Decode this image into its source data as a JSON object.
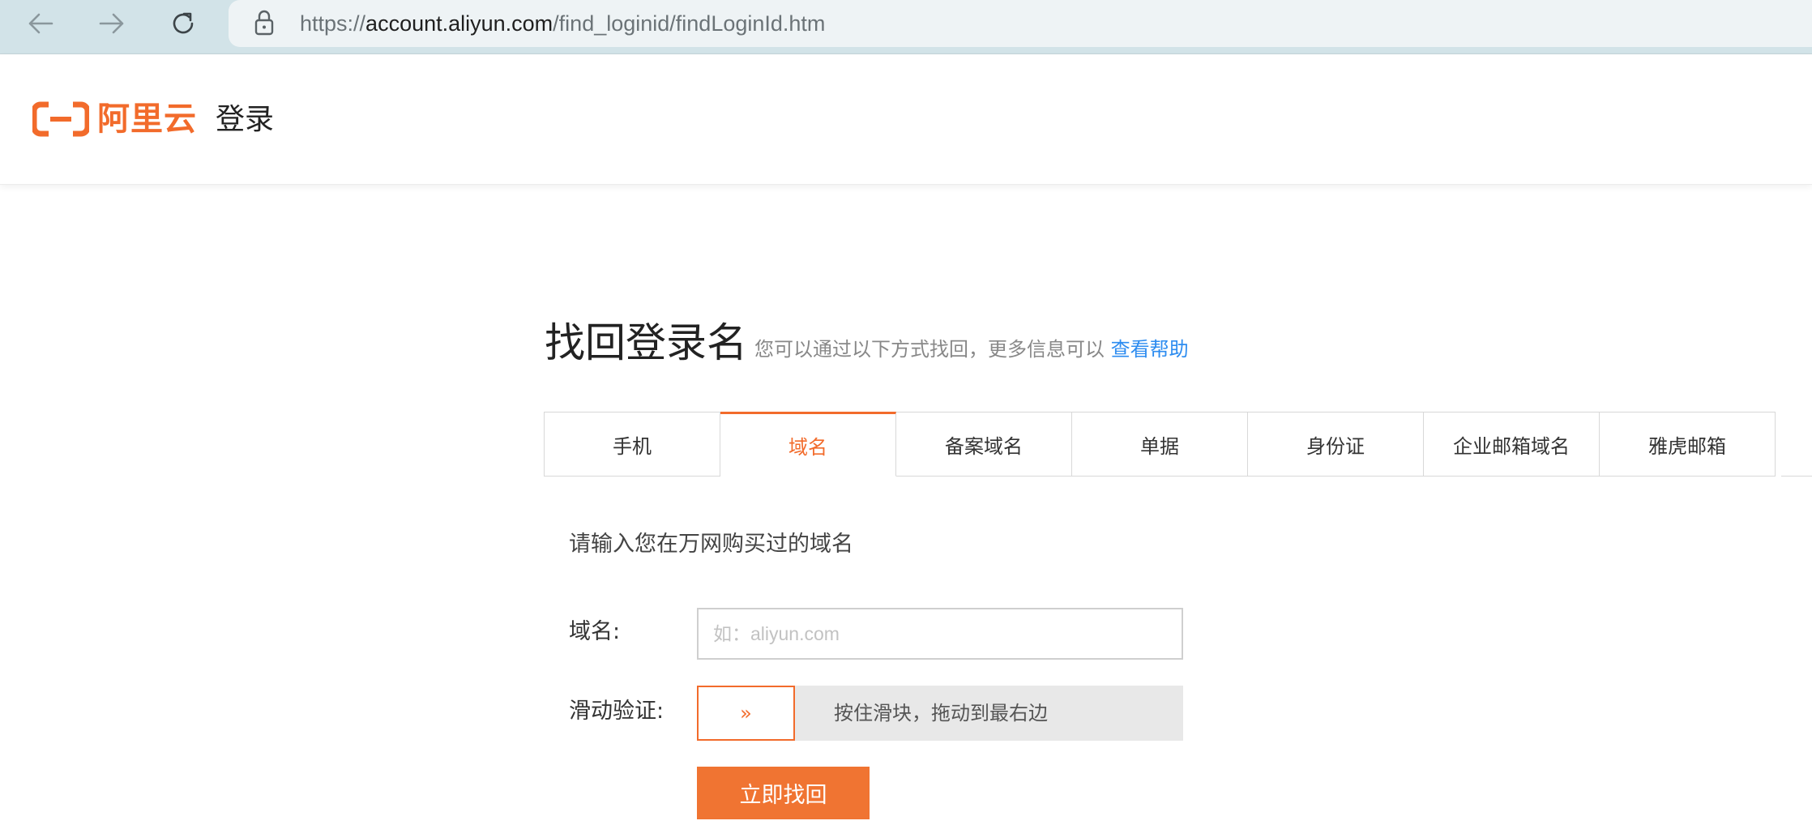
{
  "browser": {
    "url_scheme": "https://",
    "url_host": "account.aliyun.com",
    "url_path": "/find_loginid/findLoginId.htm",
    "icons": [
      "back-icon",
      "forward-icon",
      "reload-icon",
      "lock-icon"
    ]
  },
  "header": {
    "logo_text": "阿里云",
    "title": "登录",
    "brand_color": "#f26b2b"
  },
  "main": {
    "title": "找回登录名",
    "subtitle": "您可以通过以下方式找回，更多信息可以",
    "help_link": "查看帮助",
    "tabs": [
      {
        "label": "手机",
        "active": false
      },
      {
        "label": "域名",
        "active": true
      },
      {
        "label": "备案域名",
        "active": false
      },
      {
        "label": "单据",
        "active": false
      },
      {
        "label": "身份证",
        "active": false
      },
      {
        "label": "企业邮箱域名",
        "active": false
      },
      {
        "label": "雅虎邮箱",
        "active": false
      }
    ],
    "instruction": "请输入您在万网购买过的域名",
    "domain_label": "域名:",
    "domain_placeholder": "如：aliyun.com",
    "domain_value": "",
    "slider_label": "滑动验证:",
    "slider_handle": "»",
    "slider_text": "按住滑块，拖动到最右边",
    "submit_label": "立即找回"
  }
}
